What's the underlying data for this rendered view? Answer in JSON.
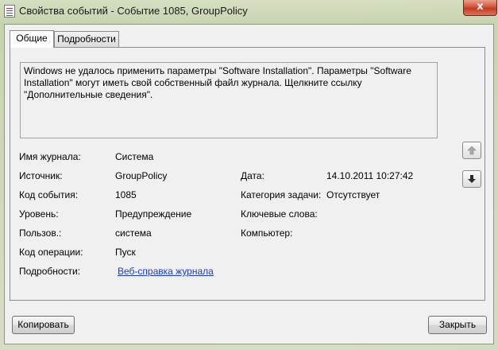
{
  "window": {
    "title": "Свойства событий - Событие 1085, GroupPolicy",
    "close_glyph": "x"
  },
  "tabs": [
    {
      "label": "Общие",
      "active": true
    },
    {
      "label": "Подробности",
      "active": false
    }
  ],
  "description": "Windows не удалось применить параметры \"Software Installation\". Параметры \"Software Installation\" могут иметь свой собственный файл журнала. Щелкните ссылку \"Дополнительные сведения\".",
  "fields": {
    "log_name": {
      "label": "Имя журнала:",
      "value": "Система"
    },
    "source": {
      "label": "Источник:",
      "value": "GroupPolicy"
    },
    "event_id": {
      "label": "Код события:",
      "value": "1085"
    },
    "level": {
      "label": "Уровень:",
      "value": "Предупреждение"
    },
    "user": {
      "label": "Пользов.:",
      "value": "система"
    },
    "opcode": {
      "label": "Код операции:",
      "value": "Пуск"
    },
    "more_info": {
      "label": "Подробности:",
      "value": "Веб-справка журнала"
    },
    "date": {
      "label": "Дата:",
      "value": "14.10.2011 10:27:42"
    },
    "task_category": {
      "label": "Категория задачи:",
      "value": "Отсутствует"
    },
    "keywords": {
      "label": "Ключевые слова:",
      "value": ""
    },
    "computer": {
      "label": "Компьютер:",
      "value": ""
    }
  },
  "nav": {
    "up_icon": "arrow-up-icon",
    "down_icon": "arrow-down-icon"
  },
  "buttons": {
    "copy": "Копировать",
    "close": "Закрыть"
  },
  "colors": {
    "link": "#1a3bd1",
    "close_button": "#c23a22"
  }
}
